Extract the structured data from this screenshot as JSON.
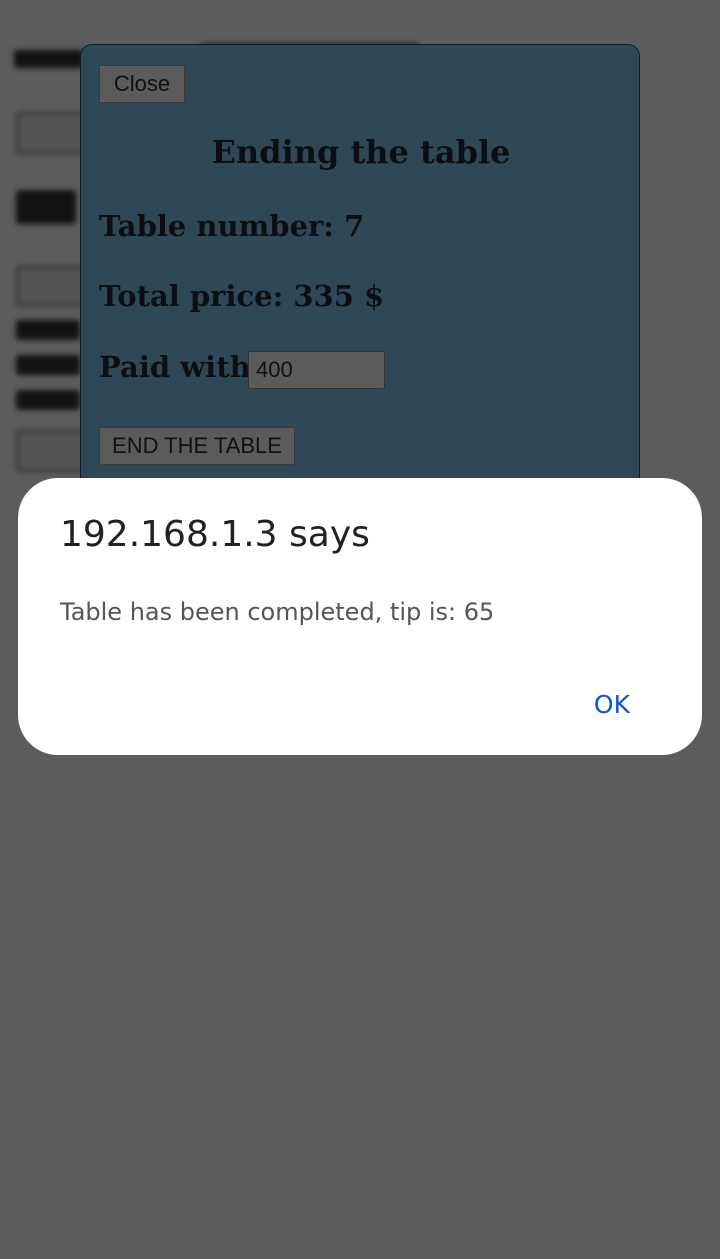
{
  "modal": {
    "close_label": "Close",
    "title": "Ending the table",
    "table_number_label": "Table number: 7",
    "total_price_label": "Total price: 335 $",
    "paid_with_label": "Paid with:",
    "paid_with_value": "400",
    "end_button_label": "END THE TABLE"
  },
  "alert": {
    "title": "192.168.1.3 says",
    "message": "Table has been completed, tip is: 65",
    "ok_label": "OK"
  }
}
